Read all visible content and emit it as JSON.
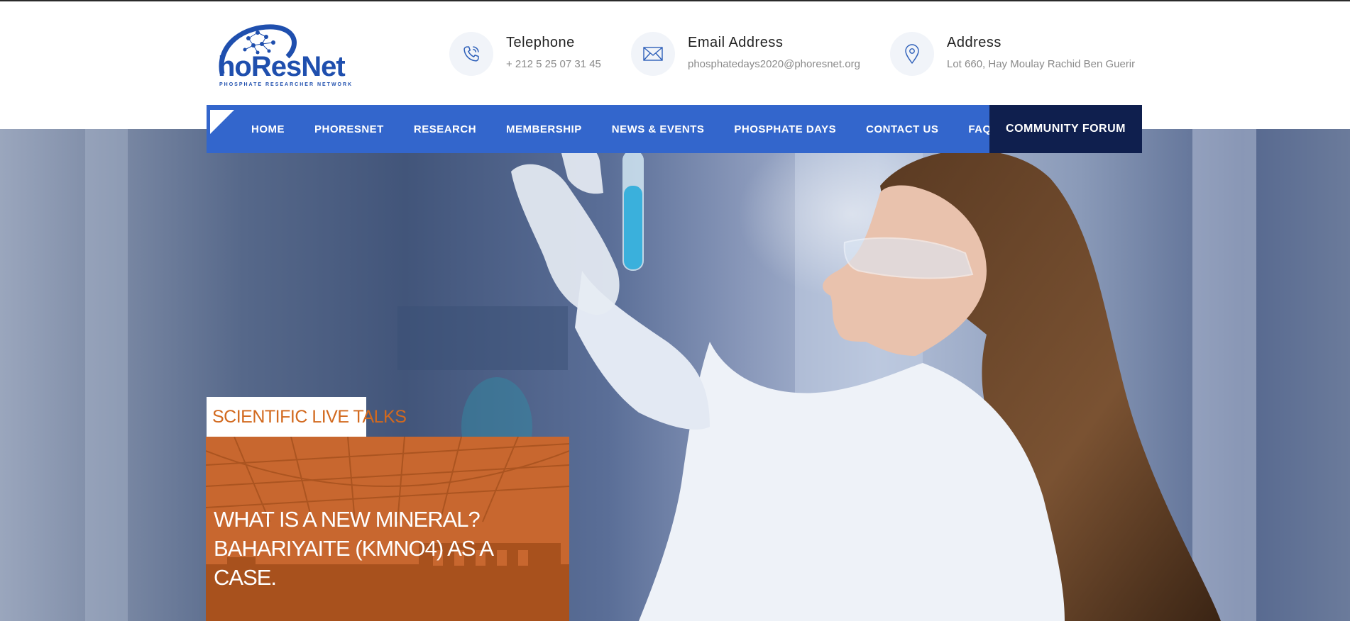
{
  "brand": {
    "logo_text": "hoResNet",
    "logo_tagline": "PHOSPHATE RESEARCHER NETWORK",
    "primary_color": "#3366cc",
    "dark_color": "#0f1f4e",
    "accent_color": "#d2691e"
  },
  "contacts": [
    {
      "icon": "phone-icon",
      "title": "Telephone",
      "value": "+ 212 5 25 07 31 45"
    },
    {
      "icon": "envelope-icon",
      "title": "Email Address",
      "value": "phosphatedays2020@phoresnet.org"
    },
    {
      "icon": "map-pin-icon",
      "title": "Address",
      "value": "Lot 660, Hay Moulay Rachid Ben Guerir"
    }
  ],
  "nav": {
    "items": [
      "HOME",
      "PHORESNET",
      "RESEARCH",
      "MEMBERSHIP",
      "NEWS & EVENTS",
      "PHOSPHATE DAYS",
      "CONTACT US",
      "FAQS"
    ],
    "cta": "COMMUNITY FORUM"
  },
  "hero": {
    "badge": "SCIENTIFIC LIVE TALKS",
    "card_title": "WHAT IS A NEW MINERAL?\nBAHARIYAITE (KMNO4) AS A CASE."
  }
}
